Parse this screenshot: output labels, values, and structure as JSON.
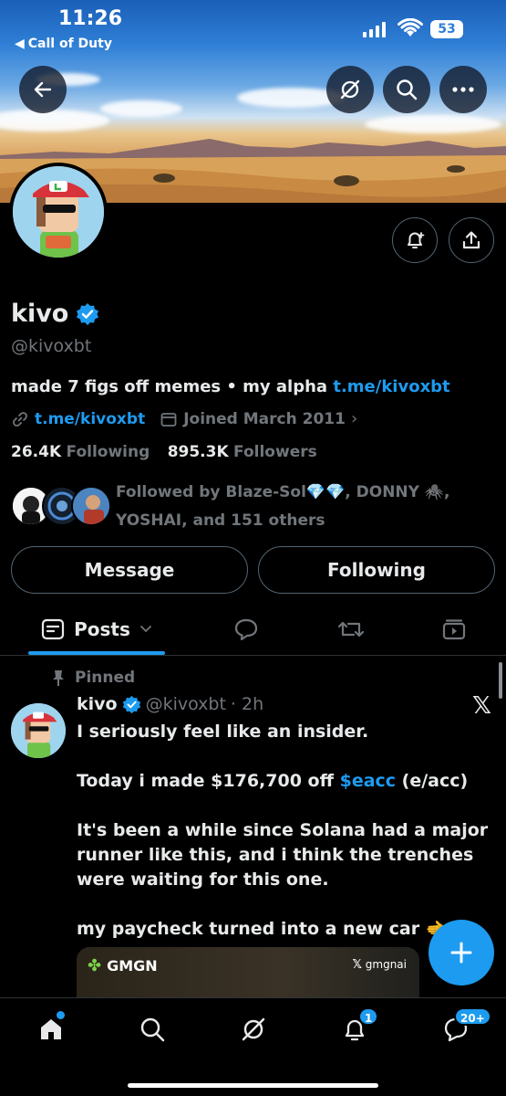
{
  "status_bar": {
    "time": "11:26",
    "back_app": "Call of Duty",
    "battery": "53"
  },
  "profile": {
    "name": "kivo",
    "handle": "@kivoxbt",
    "bio_text": "made 7 figs off memes • my alpha ",
    "bio_link": "t.me/kivoxbt",
    "website": "t.me/kivoxbt",
    "joined": "Joined March 2011",
    "following_count": "26.4K",
    "following_label": "Following",
    "followers_count": "895.3K",
    "followers_label": "Followers",
    "followed_by": "Followed by Blaze-Sol💎💎, DONNY 🕷️, YOSHAI, and 151 others"
  },
  "actions": {
    "message": "Message",
    "following": "Following"
  },
  "tabs": {
    "active": "Posts"
  },
  "post": {
    "pinned_label": "Pinned",
    "author": "kivo",
    "handle": "@kivoxbt",
    "time": "· 2h",
    "line1": "I seriously feel like an insider.",
    "line2_pre": "Today i made $176,700 off ",
    "line2_cash": "$eacc",
    "line2_post": " (e/acc)",
    "line3": "It's been a while since Solana had a major runner like this, and i think the trenches were waiting for this one.",
    "line4": "my paycheck turned into a new car 🫲",
    "media_brand": "GMGN",
    "media_watermark": "gmgnai"
  },
  "nav": {
    "notifications_badge": "1",
    "messages_badge": "20+"
  },
  "colors": {
    "accent": "#1d9bf0",
    "secondary_text": "#71767b",
    "border": "#2f3336"
  }
}
